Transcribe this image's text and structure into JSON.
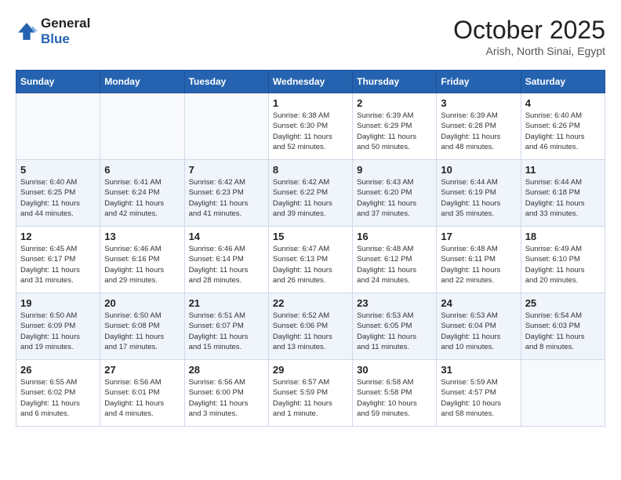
{
  "header": {
    "logo_line1": "General",
    "logo_line2": "Blue",
    "month": "October 2025",
    "location": "Arish, North Sinai, Egypt"
  },
  "weekdays": [
    "Sunday",
    "Monday",
    "Tuesday",
    "Wednesday",
    "Thursday",
    "Friday",
    "Saturday"
  ],
  "weeks": [
    [
      {
        "day": "",
        "info": ""
      },
      {
        "day": "",
        "info": ""
      },
      {
        "day": "",
        "info": ""
      },
      {
        "day": "1",
        "info": "Sunrise: 6:38 AM\nSunset: 6:30 PM\nDaylight: 11 hours\nand 52 minutes."
      },
      {
        "day": "2",
        "info": "Sunrise: 6:39 AM\nSunset: 6:29 PM\nDaylight: 11 hours\nand 50 minutes."
      },
      {
        "day": "3",
        "info": "Sunrise: 6:39 AM\nSunset: 6:28 PM\nDaylight: 11 hours\nand 48 minutes."
      },
      {
        "day": "4",
        "info": "Sunrise: 6:40 AM\nSunset: 6:26 PM\nDaylight: 11 hours\nand 46 minutes."
      }
    ],
    [
      {
        "day": "5",
        "info": "Sunrise: 6:40 AM\nSunset: 6:25 PM\nDaylight: 11 hours\nand 44 minutes."
      },
      {
        "day": "6",
        "info": "Sunrise: 6:41 AM\nSunset: 6:24 PM\nDaylight: 11 hours\nand 42 minutes."
      },
      {
        "day": "7",
        "info": "Sunrise: 6:42 AM\nSunset: 6:23 PM\nDaylight: 11 hours\nand 41 minutes."
      },
      {
        "day": "8",
        "info": "Sunrise: 6:42 AM\nSunset: 6:22 PM\nDaylight: 11 hours\nand 39 minutes."
      },
      {
        "day": "9",
        "info": "Sunrise: 6:43 AM\nSunset: 6:20 PM\nDaylight: 11 hours\nand 37 minutes."
      },
      {
        "day": "10",
        "info": "Sunrise: 6:44 AM\nSunset: 6:19 PM\nDaylight: 11 hours\nand 35 minutes."
      },
      {
        "day": "11",
        "info": "Sunrise: 6:44 AM\nSunset: 6:18 PM\nDaylight: 11 hours\nand 33 minutes."
      }
    ],
    [
      {
        "day": "12",
        "info": "Sunrise: 6:45 AM\nSunset: 6:17 PM\nDaylight: 11 hours\nand 31 minutes."
      },
      {
        "day": "13",
        "info": "Sunrise: 6:46 AM\nSunset: 6:16 PM\nDaylight: 11 hours\nand 29 minutes."
      },
      {
        "day": "14",
        "info": "Sunrise: 6:46 AM\nSunset: 6:14 PM\nDaylight: 11 hours\nand 28 minutes."
      },
      {
        "day": "15",
        "info": "Sunrise: 6:47 AM\nSunset: 6:13 PM\nDaylight: 11 hours\nand 26 minutes."
      },
      {
        "day": "16",
        "info": "Sunrise: 6:48 AM\nSunset: 6:12 PM\nDaylight: 11 hours\nand 24 minutes."
      },
      {
        "day": "17",
        "info": "Sunrise: 6:48 AM\nSunset: 6:11 PM\nDaylight: 11 hours\nand 22 minutes."
      },
      {
        "day": "18",
        "info": "Sunrise: 6:49 AM\nSunset: 6:10 PM\nDaylight: 11 hours\nand 20 minutes."
      }
    ],
    [
      {
        "day": "19",
        "info": "Sunrise: 6:50 AM\nSunset: 6:09 PM\nDaylight: 11 hours\nand 19 minutes."
      },
      {
        "day": "20",
        "info": "Sunrise: 6:50 AM\nSunset: 6:08 PM\nDaylight: 11 hours\nand 17 minutes."
      },
      {
        "day": "21",
        "info": "Sunrise: 6:51 AM\nSunset: 6:07 PM\nDaylight: 11 hours\nand 15 minutes."
      },
      {
        "day": "22",
        "info": "Sunrise: 6:52 AM\nSunset: 6:06 PM\nDaylight: 11 hours\nand 13 minutes."
      },
      {
        "day": "23",
        "info": "Sunrise: 6:53 AM\nSunset: 6:05 PM\nDaylight: 11 hours\nand 11 minutes."
      },
      {
        "day": "24",
        "info": "Sunrise: 6:53 AM\nSunset: 6:04 PM\nDaylight: 11 hours\nand 10 minutes."
      },
      {
        "day": "25",
        "info": "Sunrise: 6:54 AM\nSunset: 6:03 PM\nDaylight: 11 hours\nand 8 minutes."
      }
    ],
    [
      {
        "day": "26",
        "info": "Sunrise: 6:55 AM\nSunset: 6:02 PM\nDaylight: 11 hours\nand 6 minutes."
      },
      {
        "day": "27",
        "info": "Sunrise: 6:56 AM\nSunset: 6:01 PM\nDaylight: 11 hours\nand 4 minutes."
      },
      {
        "day": "28",
        "info": "Sunrise: 6:56 AM\nSunset: 6:00 PM\nDaylight: 11 hours\nand 3 minutes."
      },
      {
        "day": "29",
        "info": "Sunrise: 6:57 AM\nSunset: 5:59 PM\nDaylight: 11 hours\nand 1 minute."
      },
      {
        "day": "30",
        "info": "Sunrise: 6:58 AM\nSunset: 5:58 PM\nDaylight: 10 hours\nand 59 minutes."
      },
      {
        "day": "31",
        "info": "Sunrise: 5:59 AM\nSunset: 4:57 PM\nDaylight: 10 hours\nand 58 minutes."
      },
      {
        "day": "",
        "info": ""
      }
    ]
  ]
}
